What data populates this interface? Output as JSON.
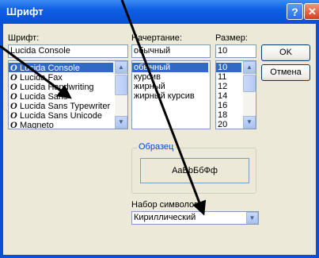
{
  "dialog": {
    "title": "Шрифт",
    "help_icon": "?",
    "close_icon": "✕"
  },
  "font": {
    "label": "Шрифт:",
    "value": "Lucida Console",
    "items": [
      {
        "glyph": "O",
        "name": "Lucida Console",
        "selected": true
      },
      {
        "glyph": "O",
        "name": "Lucida Fax",
        "selected": false
      },
      {
        "glyph": "O",
        "name": "Lucida Handwriting",
        "selected": false
      },
      {
        "glyph": "O",
        "name": "Lucida Sans",
        "selected": false
      },
      {
        "glyph": "O",
        "name": "Lucida Sans Typewriter",
        "selected": false
      },
      {
        "glyph": "O",
        "name": "Lucida Sans Unicode",
        "selected": false
      },
      {
        "glyph": "O",
        "name": "Magneto",
        "selected": false
      }
    ]
  },
  "style": {
    "label": "Начертание:",
    "value": "обычный",
    "items": [
      {
        "name": "обычный",
        "selected": true
      },
      {
        "name": "курсив",
        "selected": false
      },
      {
        "name": "жирный",
        "selected": false
      },
      {
        "name": "жирный курсив",
        "selected": false
      }
    ]
  },
  "size": {
    "label": "Размер:",
    "value": "10",
    "items": [
      {
        "name": "10",
        "selected": true
      },
      {
        "name": "11",
        "selected": false
      },
      {
        "name": "12",
        "selected": false
      },
      {
        "name": "14",
        "selected": false
      },
      {
        "name": "16",
        "selected": false
      },
      {
        "name": "18",
        "selected": false
      },
      {
        "name": "20",
        "selected": false
      }
    ]
  },
  "buttons": {
    "ok": "OK",
    "cancel": "Отмена"
  },
  "sample": {
    "title": "Образец",
    "text": "AaBbБбФф"
  },
  "charset": {
    "label": "Набор символов:",
    "value": "Кириллический"
  },
  "icons": {
    "scroll_up": "▲",
    "scroll_down": "▼",
    "dropdown": "▼"
  },
  "colors": {
    "titlebar": "#0a4fd6",
    "selection": "#316ac5",
    "dialog_bg": "#ece9d8",
    "group_title": "#0046d5",
    "annotation_arrow": "#000000"
  }
}
